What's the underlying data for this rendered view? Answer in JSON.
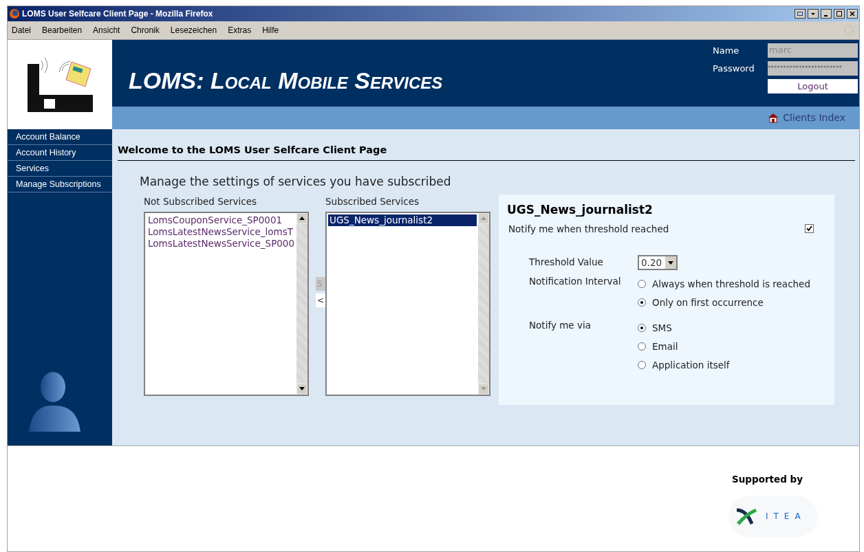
{
  "window": {
    "title": "LOMS User Selfcare Client Page - Mozilla Firefox"
  },
  "menu": [
    "Datei",
    "Bearbeiten",
    "Ansicht",
    "Chronik",
    "Lesezeichen",
    "Extras",
    "Hilfe"
  ],
  "header": {
    "title": "LOMS: Local Mobile Services",
    "name_label": "Name",
    "name_value": "marc",
    "password_label": "Password",
    "password_value": "************************",
    "logout": "Logout",
    "nav_link": "Clients Index"
  },
  "sidebar": {
    "items": [
      {
        "label": "Account Balance",
        "selected": false
      },
      {
        "label": "Account History",
        "selected": false
      },
      {
        "label": "Services",
        "selected": false
      },
      {
        "label": "Manage Subscriptions",
        "selected": false
      }
    ]
  },
  "heading": "Welcome to the LOMS User Selfcare Client Page",
  "subtitle": "Manage the settings of services you have subscribed",
  "not_subscribed": {
    "label": "Not Subscribed Services",
    "items": [
      {
        "text": "LomsCouponService_SP0001",
        "selected": false
      },
      {
        "text": "LomsLatestNewsService_lomsT",
        "selected": false
      },
      {
        "text": "LomsLatestNewsService_SP000",
        "selected": false
      }
    ]
  },
  "move_buttons": [
    "S",
    "<"
  ],
  "subscribed": {
    "label": "Subscribed Services",
    "items": [
      {
        "text": "UGS_News_journalist2",
        "selected": true
      }
    ]
  },
  "detail": {
    "title": "UGS_News_journalist2",
    "notify": {
      "label": "Notify me when threshold reached",
      "checked": true
    },
    "threshold": {
      "label": "Threshold Value",
      "value": "0.20"
    },
    "interval": {
      "label": "Notification Interval",
      "options": [
        {
          "label": "Always when threshold is reached",
          "selected": false
        },
        {
          "label": "Only on first occurrence",
          "selected": true
        }
      ]
    },
    "via": {
      "label": "Notify me via",
      "options": [
        {
          "label": "SMS",
          "selected": true
        },
        {
          "label": "Email",
          "selected": false
        },
        {
          "label": "Application itself",
          "selected": false
        }
      ]
    }
  },
  "footer": {
    "supported_by": "Supported by",
    "sponsor": "ITEA"
  }
}
